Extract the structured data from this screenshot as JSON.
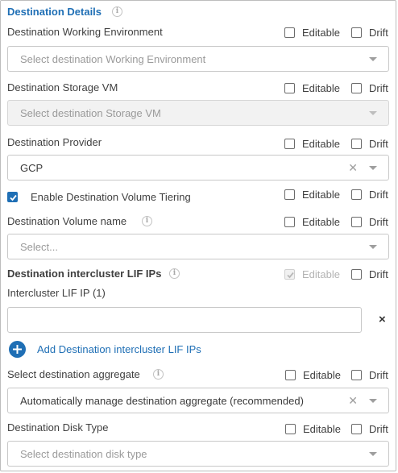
{
  "section": {
    "title": "Destination Details"
  },
  "options": {
    "editable": "Editable",
    "drift": "Drift"
  },
  "fields": {
    "working_env": {
      "label": "Destination Working Environment",
      "placeholder": "Select destination Working Environment"
    },
    "storage_vm": {
      "label": "Destination Storage VM",
      "placeholder": "Select destination Storage VM"
    },
    "provider": {
      "label": "Destination Provider",
      "value": "GCP"
    },
    "tiering": {
      "label": "Enable Destination Volume Tiering",
      "checked": true
    },
    "volume_name": {
      "label": "Destination Volume name",
      "placeholder": "Select..."
    },
    "lif_ips": {
      "label": "Destination intercluster LIF IPs",
      "sub_label": "Intercluster LIF IP (1)",
      "value": "",
      "remove_glyph": "×",
      "add_link": "Add Destination intercluster LIF IPs"
    },
    "aggregate": {
      "label": "Select destination aggregate",
      "value": "Automatically manage destination aggregate (recommended)"
    },
    "disk_type": {
      "label": "Destination Disk Type",
      "placeholder": "Select destination disk type"
    }
  },
  "icons": {
    "info": "info-icon",
    "clear": "clear-icon",
    "dropdown": "chevron-down-icon",
    "add": "plus-circle-icon",
    "check": "checkmark-icon"
  },
  "colors": {
    "accent": "#1f6fb5",
    "text": "#404040",
    "placeholder": "#9a9a9a",
    "border": "#c8c8c8",
    "disabled_bg": "#f2f2f2"
  }
}
